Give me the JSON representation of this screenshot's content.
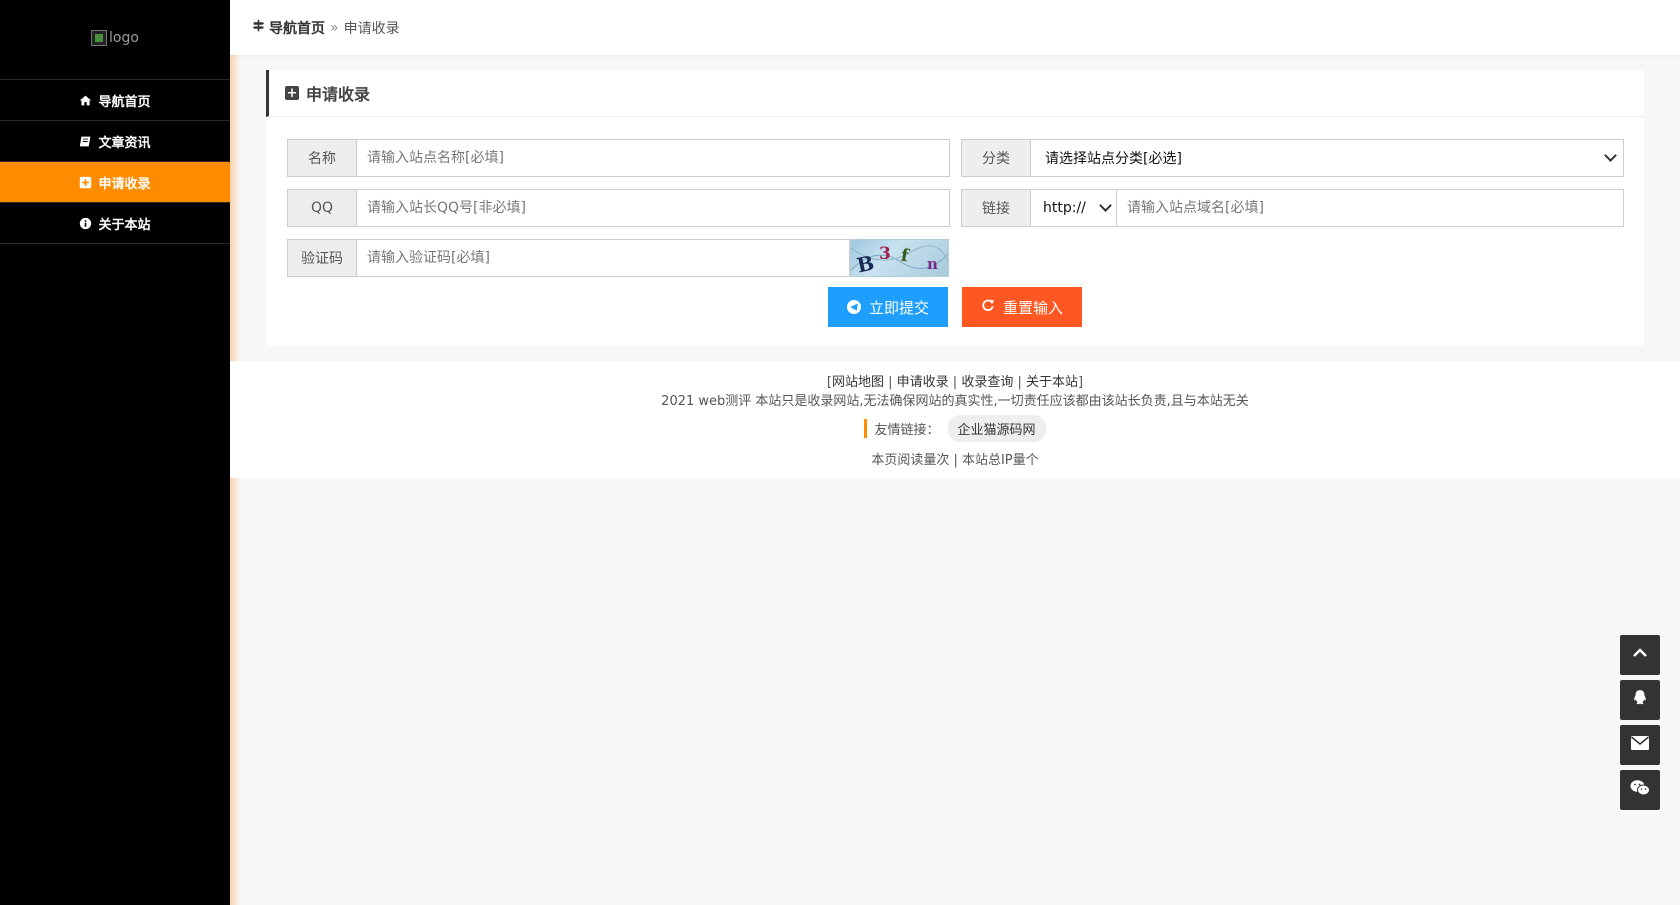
{
  "sidebar": {
    "logo_alt": "logo",
    "items": [
      {
        "label": "导航首页",
        "icon": "home-icon",
        "active": false
      },
      {
        "label": "文章资讯",
        "icon": "book-icon",
        "active": false
      },
      {
        "label": "申请收录",
        "icon": "plus-square-icon",
        "active": true
      },
      {
        "label": "关于本站",
        "icon": "info-circle-icon",
        "active": false
      }
    ]
  },
  "breadcrumb": {
    "home": "导航首页",
    "separator": "»",
    "current": "申请收录"
  },
  "panel": {
    "title": "申请收录",
    "fields": {
      "name": {
        "label": "名称",
        "placeholder": "请输入站点名称[必填]"
      },
      "category": {
        "label": "分类",
        "value": "请选择站点分类[必选]"
      },
      "qq": {
        "label": "QQ",
        "placeholder": "请输入站长QQ号[非必填]"
      },
      "url": {
        "label": "链接",
        "protocol": "http://",
        "placeholder": "请输入站点域名[必填]"
      },
      "captcha": {
        "label": "验证码",
        "placeholder": "请输入验证码[必填]",
        "image_text": [
          "B",
          "3",
          "f",
          "n"
        ]
      }
    },
    "buttons": {
      "submit": "立即提交",
      "reset": "重置输入"
    }
  },
  "footer": {
    "links": [
      "网站地图",
      "申请收录",
      "收录查询",
      "关于本站"
    ],
    "copyright": "2021 web测评 本站只是收录网站,无法确保网站的真实性,一切责任应该都由该站长负责,且与本站无关",
    "friends_label": "友情链接：",
    "friends": [
      "企业猫源码网"
    ],
    "stats": "本页阅读量次 | 本站总IP量个"
  },
  "tools": [
    "arrow-up-icon",
    "qq-icon",
    "envelope-icon",
    "wechat-icon"
  ],
  "colors": {
    "sidebar_bg": "#000000",
    "accent": "#ff8c00",
    "submit": "#1e9fff",
    "reset": "#ff5722",
    "tool_bg": "#333333"
  }
}
